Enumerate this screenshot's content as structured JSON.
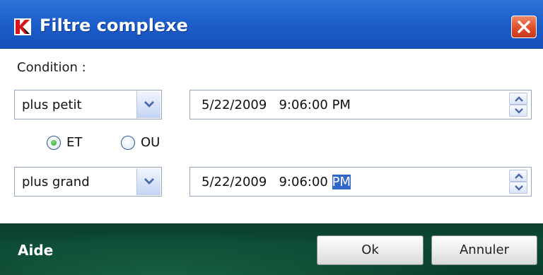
{
  "window": {
    "title": "Filtre complexe",
    "accent_color": "#1d5fcb",
    "footer_color": "#0b4a35"
  },
  "form": {
    "condition_label": "Condition :",
    "row1": {
      "operator": "plus petit",
      "date": "5/22/2009",
      "time": "9:06:00 PM"
    },
    "logic": {
      "options": [
        "ET",
        "OU"
      ],
      "selected": "ET"
    },
    "row2": {
      "operator": "plus grand",
      "date": "5/22/2009",
      "time_main": "9:06:00 ",
      "time_selected": "PM"
    }
  },
  "footer": {
    "help_label": "Aide",
    "ok_label": "Ok",
    "cancel_label": "Annuler"
  },
  "icons": {
    "app_logo": "kaspersky-logo-icon",
    "close": "close-icon",
    "dropdown": "chevron-down-icon",
    "spin_up": "arrow-up-icon",
    "spin_down": "arrow-down-icon"
  }
}
